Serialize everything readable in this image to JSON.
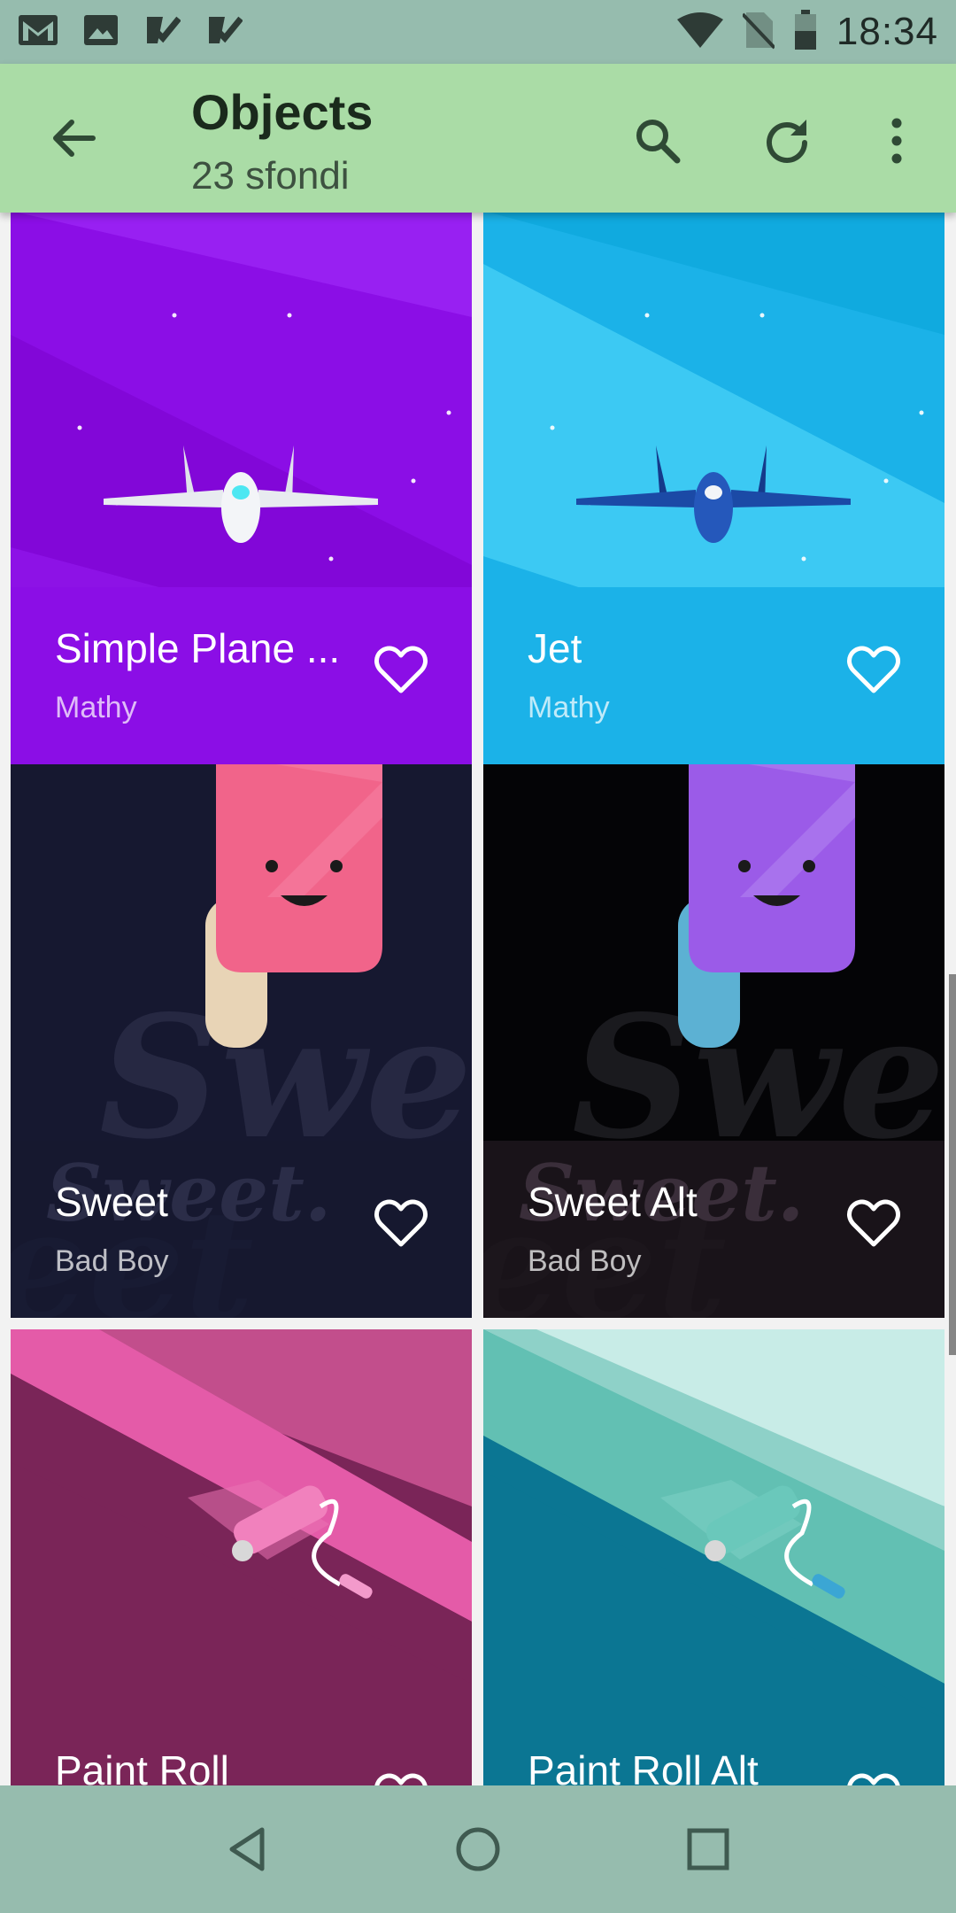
{
  "status_bar": {
    "time": "18:34",
    "left_icons": [
      "gmail-icon",
      "gallery-icon",
      "task-check-icon",
      "task-check-icon"
    ],
    "right_icons": [
      "wifi-icon",
      "no-sim-icon",
      "battery-icon"
    ]
  },
  "app_bar": {
    "title": "Objects",
    "subtitle": "23 sfondi",
    "icons": [
      "back-arrow-icon",
      "search-icon",
      "refresh-icon",
      "more-vert-icon"
    ],
    "color": "#aadca6"
  },
  "wallpapers": [
    {
      "title": "Simple Plane ...",
      "author": "Mathy",
      "color": "#8b0ee6"
    },
    {
      "title": "Jet",
      "author": "Mathy",
      "color": "#1bb2e8"
    },
    {
      "title": "Sweet",
      "author": "Bad Boy",
      "color": "#161830"
    },
    {
      "title": "Sweet Alt",
      "author": "Bad Boy",
      "color": "#040406"
    },
    {
      "title": "Paint Roll",
      "author": "",
      "color": "#7a2558"
    },
    {
      "title": "Paint Roll Alt",
      "author": "",
      "color": "#0b7693"
    }
  ],
  "nav_bar": {
    "icons": [
      "back-triangle-icon",
      "home-circle-icon",
      "recents-square-icon"
    ]
  }
}
